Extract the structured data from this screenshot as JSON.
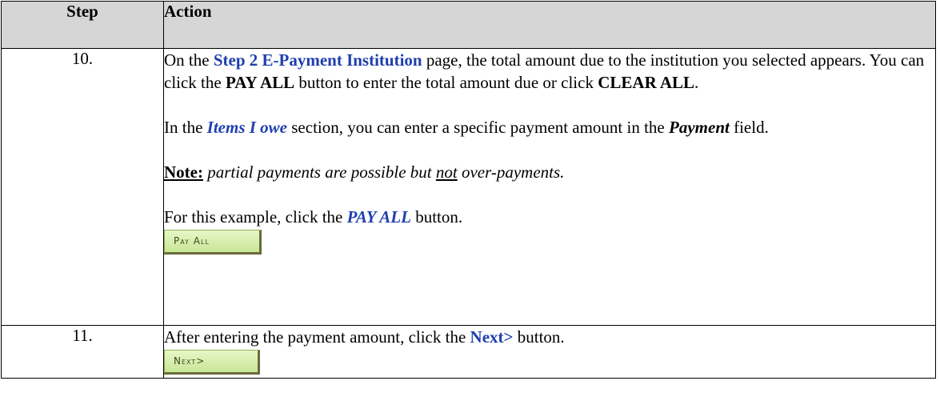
{
  "table": {
    "header": {
      "step": "Step",
      "action": "Action"
    },
    "rows": [
      {
        "number": "10.",
        "p1": {
          "t1": "On the ",
          "page_name": "Step 2 E-Payment Institution",
          "t2": " page, the total amount due to the institution you selected appears. You can click the ",
          "pay_all": "PAY ALL",
          "t3": " button to enter the total amount due or click ",
          "clear_all": "CLEAR ALL",
          "t4": "."
        },
        "p2": {
          "t1": "In the ",
          "section": "Items I owe",
          "t2": " section, you can enter a specific payment amount in the ",
          "field": "Payment",
          "t3": " field."
        },
        "p3": {
          "note": "Note:",
          "t1": " partial payments are possible but ",
          "not": "not",
          "t2": " over-payments."
        },
        "p4": {
          "t1": "For this example, click the ",
          "button_ref": "PAY ALL",
          "t2": " button."
        },
        "button_label": "Pay All"
      },
      {
        "number": "11.",
        "p1": {
          "t1": "After entering the payment amount, click the ",
          "next": "Next>",
          "t2": " button."
        },
        "button_label": "Next>"
      }
    ]
  },
  "colors": {
    "header_bg": "#d6d6d6",
    "link_blue": "#1f3fae",
    "button_green": "#c7e696"
  }
}
